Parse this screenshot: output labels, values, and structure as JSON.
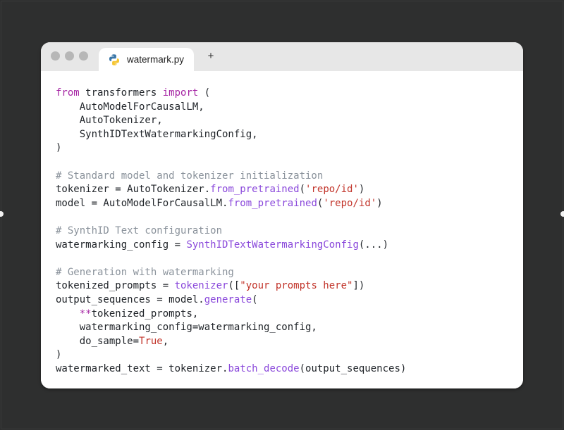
{
  "window": {
    "tab": {
      "file_name": "watermark.py",
      "icon": "python-icon"
    },
    "new_tab_label": "+",
    "traffic_lights": [
      "close-dot",
      "minimize-dot",
      "maximize-dot"
    ]
  },
  "colors": {
    "background": "#2e2f2f",
    "keyword": "#a626a4",
    "function": "#8a48db",
    "string": "#c2342a",
    "comment": "#8a929b",
    "text": "#1f2328"
  },
  "code": [
    [
      [
        "kw",
        "from"
      ],
      [
        "p",
        " transformers "
      ],
      [
        "kw",
        "import"
      ],
      [
        "p",
        " ("
      ]
    ],
    [
      [
        "p",
        "    AutoModelForCausalLM,"
      ]
    ],
    [
      [
        "p",
        "    AutoTokenizer,"
      ]
    ],
    [
      [
        "p",
        "    SynthIDTextWatermarkingConfig,"
      ]
    ],
    [
      [
        "p",
        ")"
      ]
    ],
    [],
    [
      [
        "com",
        "# Standard model and tokenizer initialization"
      ]
    ],
    [
      [
        "p",
        "tokenizer = AutoTokenizer."
      ],
      [
        "fn",
        "from_pretrained"
      ],
      [
        "p",
        "("
      ],
      [
        "str",
        "'repo/id'"
      ],
      [
        "p",
        ")"
      ]
    ],
    [
      [
        "p",
        "model = AutoModelForCausalLM."
      ],
      [
        "fn",
        "from_pretrained"
      ],
      [
        "p",
        "("
      ],
      [
        "str",
        "'repo/id'"
      ],
      [
        "p",
        ")"
      ]
    ],
    [],
    [
      [
        "com",
        "# SynthID Text configuration"
      ]
    ],
    [
      [
        "p",
        "watermarking_config = "
      ],
      [
        "fn",
        "SynthIDTextWatermarkingConfig"
      ],
      [
        "p",
        "(...)"
      ]
    ],
    [],
    [
      [
        "com",
        "# Generation with watermarking"
      ]
    ],
    [
      [
        "p",
        "tokenized_prompts = "
      ],
      [
        "fn",
        "tokenizer"
      ],
      [
        "p",
        "(["
      ],
      [
        "str",
        "\"your prompts here\""
      ],
      [
        "p",
        "])"
      ]
    ],
    [
      [
        "p",
        "output_sequences = model."
      ],
      [
        "fn",
        "generate"
      ],
      [
        "p",
        "("
      ]
    ],
    [
      [
        "p",
        "    "
      ],
      [
        "kw",
        "**"
      ],
      [
        "p",
        "tokenized_prompts,"
      ]
    ],
    [
      [
        "p",
        "    watermarking_config=watermarking_config,"
      ]
    ],
    [
      [
        "p",
        "    do_sample="
      ],
      [
        "str",
        "True"
      ],
      [
        "p",
        ","
      ]
    ],
    [
      [
        "p",
        ")"
      ]
    ],
    [
      [
        "p",
        "watermarked_text = tokenizer."
      ],
      [
        "fn",
        "batch_decode"
      ],
      [
        "p",
        "(output_sequences)"
      ]
    ]
  ]
}
